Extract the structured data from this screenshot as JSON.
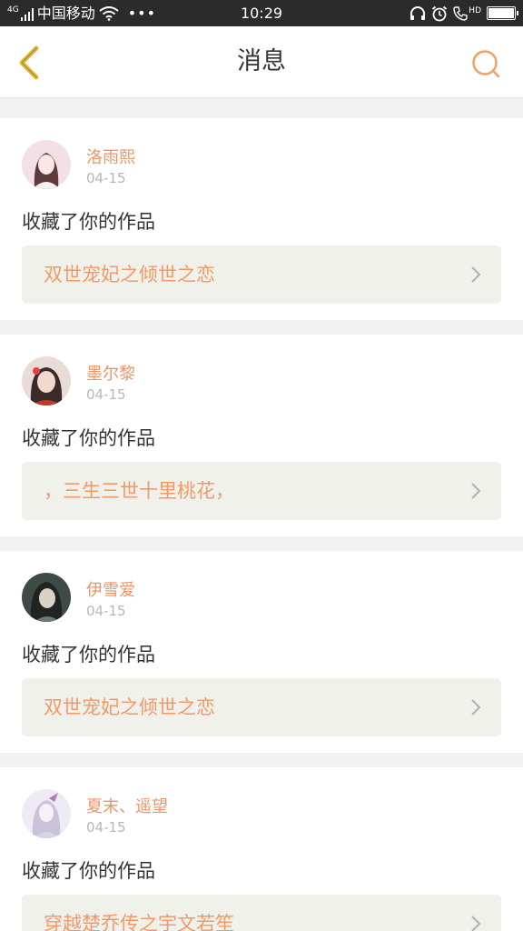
{
  "status_bar": {
    "network": "4G",
    "carrier": "中国移动",
    "time": "10:29",
    "hd": "HD"
  },
  "nav": {
    "title": "消息"
  },
  "colors": {
    "accent": "#ef9a67",
    "name": "#e8956a",
    "back": "#e0b63a"
  },
  "messages": [
    {
      "user": "洛雨熙",
      "date": "04-15",
      "action": "收藏了你的作品",
      "work": "双世宠妃之倾世之恋"
    },
    {
      "user": "墨尔黎",
      "date": "04-15",
      "action": "收藏了你的作品",
      "work": "，三生三世十里桃花，"
    },
    {
      "user": "伊雪爱",
      "date": "04-15",
      "action": "收藏了你的作品",
      "work": "双世宠妃之倾世之恋"
    },
    {
      "user": "夏末、遥望",
      "date": "04-15",
      "action": "收藏了你的作品",
      "work": "穿越楚乔传之宇文若笙"
    }
  ]
}
